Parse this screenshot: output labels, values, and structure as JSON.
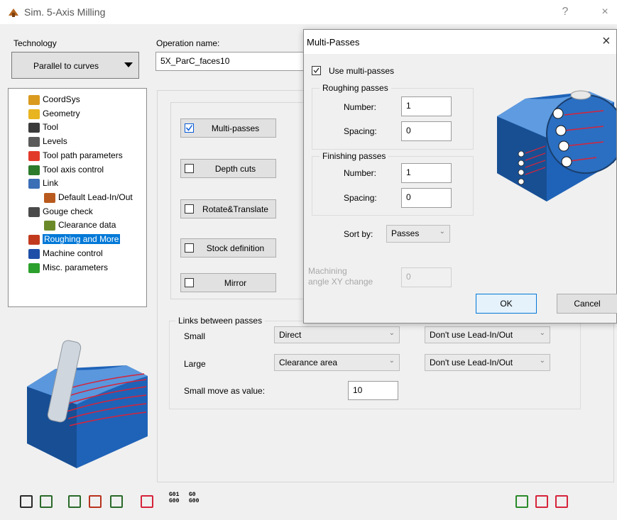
{
  "window": {
    "title": "Sim. 5-Axis Milling",
    "help_label": "?",
    "close_label": "×"
  },
  "technology": {
    "label": "Technology",
    "value": "Parallel to curves"
  },
  "operation": {
    "label": "Operation name:",
    "value": "5X_ParC_faces10"
  },
  "tree": [
    {
      "label": "CoordSys",
      "icon": "coordsys-icon"
    },
    {
      "label": "Geometry",
      "icon": "geometry-icon"
    },
    {
      "label": "Tool",
      "icon": "tool-icon"
    },
    {
      "label": "Levels",
      "icon": "levels-icon"
    },
    {
      "label": "Tool path parameters",
      "icon": "toolpath-icon"
    },
    {
      "label": "Tool axis control",
      "icon": "tool-axis-icon"
    },
    {
      "label": "Link",
      "icon": "link-icon"
    },
    {
      "label": "Default Lead-In/Out",
      "icon": "lead-in-out-icon"
    },
    {
      "label": "Gouge check",
      "icon": "gouge-check-icon"
    },
    {
      "label": "Clearance data",
      "icon": "clearance-icon"
    },
    {
      "label": "Roughing and More",
      "icon": "roughing-icon",
      "selected": true
    },
    {
      "label": "Machine control",
      "icon": "machine-control-icon"
    },
    {
      "label": "Misc. parameters",
      "icon": "misc-icon"
    }
  ],
  "options": [
    {
      "label": "Multi-passes",
      "checked": true
    },
    {
      "label": "Depth cuts",
      "checked": false
    },
    {
      "label": "Rotate&Translate",
      "checked": false
    },
    {
      "label": "Stock definition",
      "checked": false
    },
    {
      "label": "Mirror",
      "checked": false
    }
  ],
  "links": {
    "title": "Links between passes",
    "small_label": "Small",
    "small_link": "Direct",
    "small_lead": "Don't use Lead-In/Out",
    "large_label": "Large",
    "large_link": "Clearance area",
    "large_lead": "Don't use Lead-In/Out",
    "small_move_label": "Small move as value:",
    "small_move_value": "10"
  },
  "dialog": {
    "title": "Multi-Passes",
    "close_label": "×",
    "use_multi_label": "Use multi-passes",
    "use_multi_checked": true,
    "roughing": {
      "title": "Roughing passes",
      "number_label": "Number:",
      "number": "1",
      "spacing_label": "Spacing:",
      "spacing": "0"
    },
    "finishing": {
      "title": "Finishing passes",
      "number_label": "Number:",
      "number": "1",
      "spacing_label": "Spacing:",
      "spacing": "0"
    },
    "sort_label": "Sort by:",
    "sort_value": "Passes",
    "angle_label_1": "Machining",
    "angle_label_2": "angle XY change",
    "angle_value": "0",
    "ok_label": "OK",
    "cancel_label": "Cancel"
  },
  "toolbar": {
    "g01_g00_a": "G01",
    "g01_g00_b": "G00",
    "g0_g00_a": "G0",
    "g0_g00_b": "G00"
  },
  "colors": {
    "accent": "#0078d7",
    "part_blue": "#1f63b8",
    "toolpath_red": "#d6243a"
  }
}
